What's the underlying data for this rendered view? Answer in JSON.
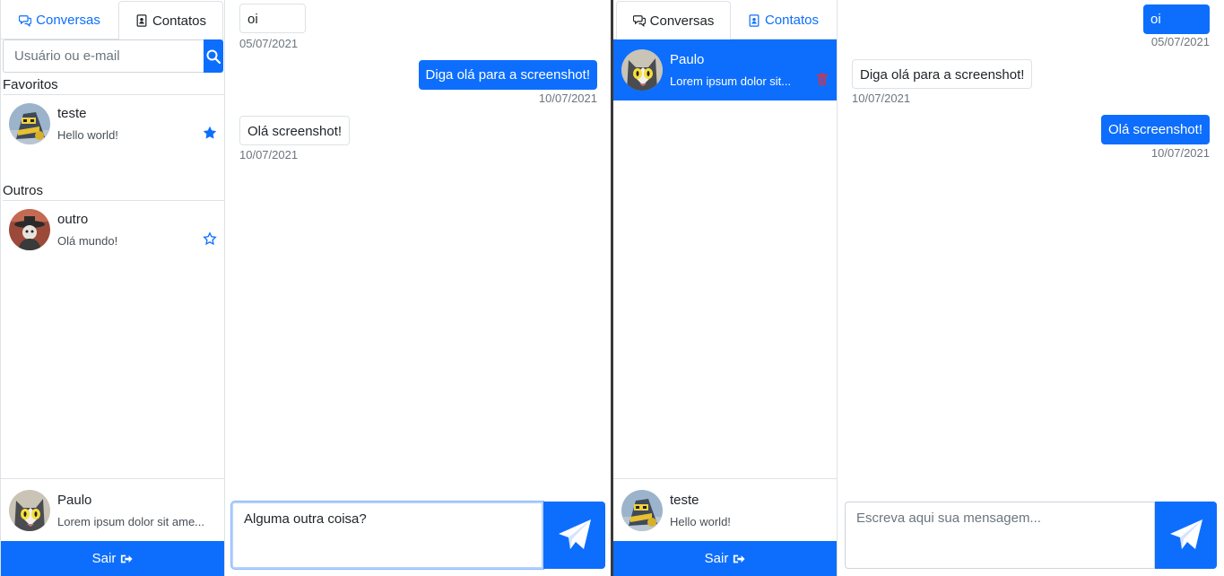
{
  "left": {
    "tabs": [
      {
        "label": "Conversas",
        "icon": "chat-icon"
      },
      {
        "label": "Contatos",
        "icon": "contact-card-icon"
      }
    ],
    "search": {
      "placeholder": "Usuário ou e-mail",
      "icon": "search-icon"
    },
    "favorites_label": "Favoritos",
    "others_label": "Outros",
    "favorites": [
      {
        "name": "teste",
        "last_message": "Hello world!",
        "favorite": true
      }
    ],
    "others": [
      {
        "name": "outro",
        "last_message": "Olá mundo!",
        "favorite": false
      }
    ],
    "current_user": {
      "name": "Paulo",
      "status": "Lorem ipsum dolor sit ame..."
    },
    "logout_label": "Sair",
    "messages": [
      {
        "text": "oi",
        "date": "05/07/2021",
        "direction": "in"
      },
      {
        "text": "Diga olá para a screenshot!",
        "date": "10/07/2021",
        "direction": "out"
      },
      {
        "text": "Olá screenshot!",
        "date": "10/07/2021",
        "direction": "in"
      }
    ],
    "composer": {
      "value": "Alguma outra coisa?",
      "placeholder": "Escreva aqui sua mensagem..."
    }
  },
  "right": {
    "tabs": [
      {
        "label": "Conversas",
        "icon": "chat-icon"
      },
      {
        "label": "Contatos",
        "icon": "contact-card-icon"
      }
    ],
    "conversations": [
      {
        "name": "Paulo",
        "last_message": "Lorem ipsum dolor sit...",
        "selected": true
      }
    ],
    "current_user": {
      "name": "teste",
      "status": "Hello world!"
    },
    "logout_label": "Sair",
    "messages": [
      {
        "text": "oi",
        "date": "05/07/2021",
        "direction": "out"
      },
      {
        "text": "Diga olá para a screenshot!",
        "date": "10/07/2021",
        "direction": "in"
      },
      {
        "text": "Olá screenshot!",
        "date": "10/07/2021",
        "direction": "out"
      }
    ],
    "composer": {
      "value": "",
      "placeholder": "Escreva aqui sua mensagem..."
    }
  },
  "colors": {
    "primary": "#0d6efd",
    "border": "#dee2e6",
    "muted": "#6c757d",
    "danger": "#dc3545"
  }
}
